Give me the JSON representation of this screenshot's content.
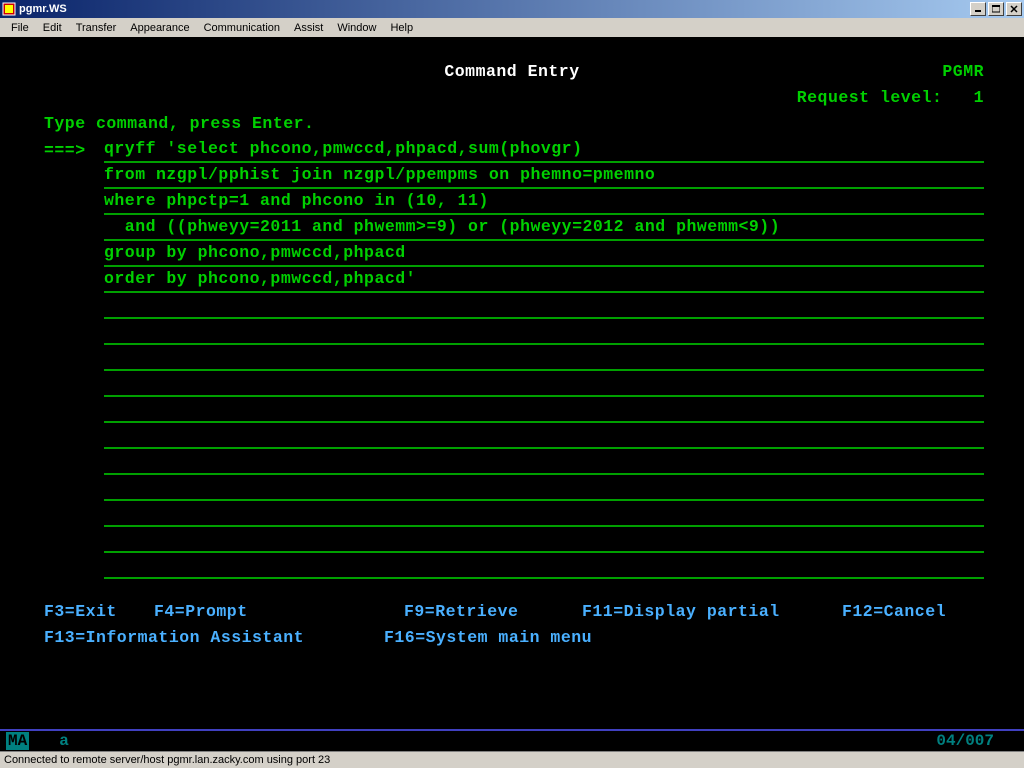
{
  "window": {
    "title": "pgmr.WS"
  },
  "menubar": [
    "File",
    "Edit",
    "Transfer",
    "Appearance",
    "Communication",
    "Assist",
    "Window",
    "Help"
  ],
  "terminal": {
    "title": "Command Entry",
    "user": "PGMR",
    "request_label": "Request level:",
    "request_level": "1",
    "prompt_text": "Type command, press Enter.",
    "cmd_prefix": "===>",
    "command_lines": [
      "qryff 'select phcono,pmwccd,phpacd,sum(phovgr)",
      "from nzgpl/pphist join nzgpl/ppempms on phemno=pmemno",
      "where phpctp=1 and phcono in (10, 11)",
      "  and ((phweyy=2011 and phwemm>=9) or (phweyy=2012 and phwemm<9))",
      "group by phcono,pmwccd,phpacd",
      "order by phcono,pmwccd,phpacd'",
      "",
      "",
      "",
      "",
      "",
      "",
      "",
      "",
      "",
      "",
      ""
    ]
  },
  "fkeys": {
    "row1": [
      "F3=Exit",
      "F4=Prompt",
      "F9=Retrieve",
      "F11=Display partial",
      "F12=Cancel"
    ],
    "row2": [
      "F13=Information Assistant",
      "F16=System main menu"
    ]
  },
  "status": {
    "indicator": "MA",
    "mode": "a",
    "cursor": "04/007"
  },
  "connection": "Connected to remote server/host pgmr.lan.zacky.com using port 23"
}
